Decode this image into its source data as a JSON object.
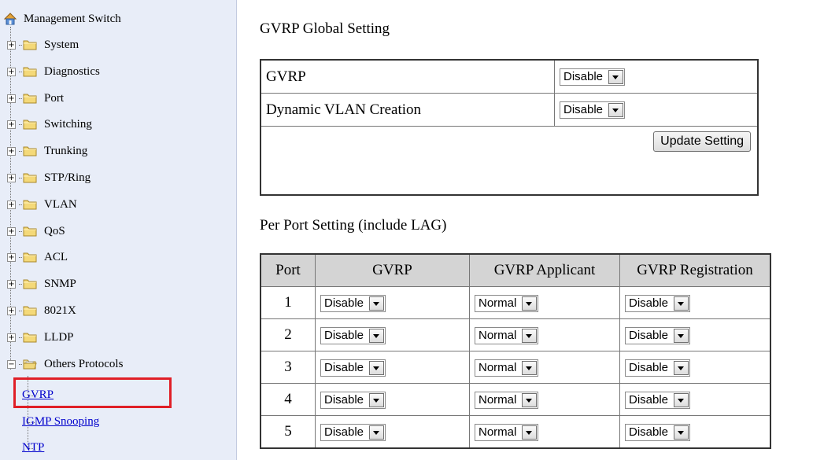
{
  "sidebar": {
    "root_label": "Management Switch",
    "root_icon": "home-network-icon",
    "folder_icon": "folder-icon",
    "items": [
      {
        "label": "System",
        "expander": "+"
      },
      {
        "label": "Diagnostics",
        "expander": "+"
      },
      {
        "label": "Port",
        "expander": "+"
      },
      {
        "label": "Switching",
        "expander": "+"
      },
      {
        "label": "Trunking",
        "expander": "+"
      },
      {
        "label": "STP/Ring",
        "expander": "+"
      },
      {
        "label": "VLAN",
        "expander": "+"
      },
      {
        "label": "QoS",
        "expander": "+"
      },
      {
        "label": "ACL",
        "expander": "+"
      },
      {
        "label": "SNMP",
        "expander": "+"
      },
      {
        "label": "8021X",
        "expander": "+"
      },
      {
        "label": "LLDP",
        "expander": "+"
      },
      {
        "label": "Others Protocols",
        "expander": "−"
      }
    ],
    "children": [
      {
        "label": "GVRP",
        "selected": true
      },
      {
        "label": "IGMP Snooping"
      },
      {
        "label": "NTP"
      }
    ],
    "highlight_color": "#e01f27"
  },
  "global": {
    "title": "GVRP Global Setting",
    "rows": [
      {
        "label": "GVRP",
        "value": "Disable"
      },
      {
        "label": "Dynamic VLAN Creation",
        "value": "Disable"
      }
    ],
    "update_button": "Update Setting"
  },
  "perport": {
    "title": "Per Port Setting (include LAG)",
    "headers": [
      "Port",
      "GVRP",
      "GVRP Applicant",
      "GVRP Registration"
    ],
    "rows": [
      {
        "port": "1",
        "gvrp": "Disable",
        "applicant": "Normal",
        "registration": "Disable"
      },
      {
        "port": "2",
        "gvrp": "Disable",
        "applicant": "Normal",
        "registration": "Disable"
      },
      {
        "port": "3",
        "gvrp": "Disable",
        "applicant": "Normal",
        "registration": "Disable"
      },
      {
        "port": "4",
        "gvrp": "Disable",
        "applicant": "Normal",
        "registration": "Disable"
      },
      {
        "port": "5",
        "gvrp": "Disable",
        "applicant": "Normal",
        "registration": "Disable"
      }
    ]
  }
}
